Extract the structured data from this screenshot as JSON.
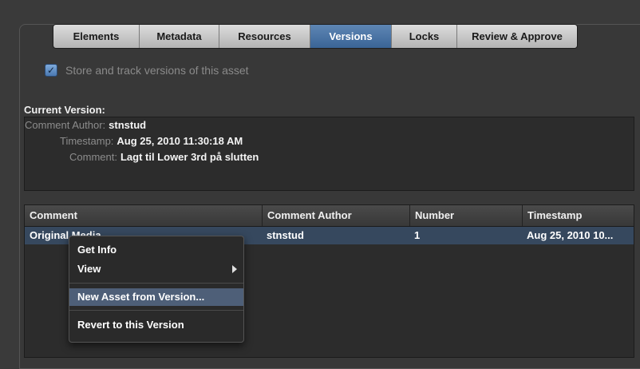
{
  "tabs": [
    {
      "label": "Elements"
    },
    {
      "label": "Metadata"
    },
    {
      "label": "Resources"
    },
    {
      "label": "Versions"
    },
    {
      "label": "Locks"
    },
    {
      "label": "Review & Approve"
    }
  ],
  "active_tab": "Versions",
  "store": {
    "checked": true,
    "label": "Store and track versions of this asset"
  },
  "current_version": {
    "title": "Current Version:",
    "author_label": "Comment Author:",
    "author_value": "stnstud",
    "timestamp_label": "Timestamp:",
    "timestamp_value": "Aug 25, 2010 11:30:18 AM",
    "comment_label": "Comment:",
    "comment_value": "Lagt til Lower 3rd på slutten"
  },
  "table": {
    "headers": [
      "Comment",
      "Comment Author",
      "Number",
      "Timestamp"
    ],
    "rows": [
      {
        "comment": "Original Media",
        "author": "stnstud",
        "number": "1",
        "timestamp": "Aug 25, 2010 10..."
      }
    ]
  },
  "context_menu": {
    "items": [
      "Get Info",
      "View",
      "New Asset from Version...",
      "Revert to this Version"
    ],
    "highlighted": "New Asset from Version..."
  },
  "colors": {
    "accent": "#3a6496",
    "selection": "#36485e",
    "menu_highlight": "#4e5f78"
  }
}
